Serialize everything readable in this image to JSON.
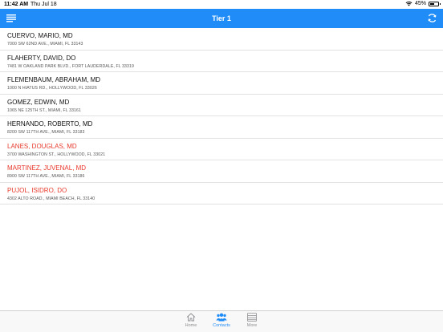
{
  "status_bar": {
    "time": "11:42 AM",
    "date": "Thu Jul 18",
    "battery": "45%"
  },
  "nav": {
    "title": "Tier 1"
  },
  "contacts": [
    {
      "name": "CUERVO, MARIO, MD",
      "address": "7000 SW 62ND AVE., MIAMI, FL 33143",
      "highlight": false
    },
    {
      "name": "FLAHERTY, DAVID, DO",
      "address": "7481 W OAKLAND PARK BLVD., FORT LAUDERDALE, FL 33319",
      "highlight": false
    },
    {
      "name": "FLEMENBAUM, ABRAHAM, MD",
      "address": "1000 N HIATUS RD., HOLLYWOOD, FL 33026",
      "highlight": false
    },
    {
      "name": "GOMEZ, EDWIN, MD",
      "address": "1065 NE 125TH ST., MIAMI, FL 33161",
      "highlight": false
    },
    {
      "name": "HERNANDO, ROBERTO, MD",
      "address": "8200 SW 117TH AVE., MIAMI, FL 33183",
      "highlight": false
    },
    {
      "name": "LANES, DOUGLAS, MD",
      "address": "3700 WASHINGTON ST., HOLLYWOOD, FL 33021",
      "highlight": true
    },
    {
      "name": "MARTINEZ, JUVENAL, MD",
      "address": "8900 SW 117TH AVE., MIAMI, FL 33186",
      "highlight": true
    },
    {
      "name": "PUJOL, ISIDRO, DO",
      "address": "4302 ALTO ROAD., MIAMI BEACH, FL 33140",
      "highlight": true
    }
  ],
  "tabbar": {
    "home": "Home",
    "contacts": "Contacts",
    "more": "More"
  },
  "colors": {
    "accent": "#1f8cf7",
    "highlight": "#e8392c"
  }
}
